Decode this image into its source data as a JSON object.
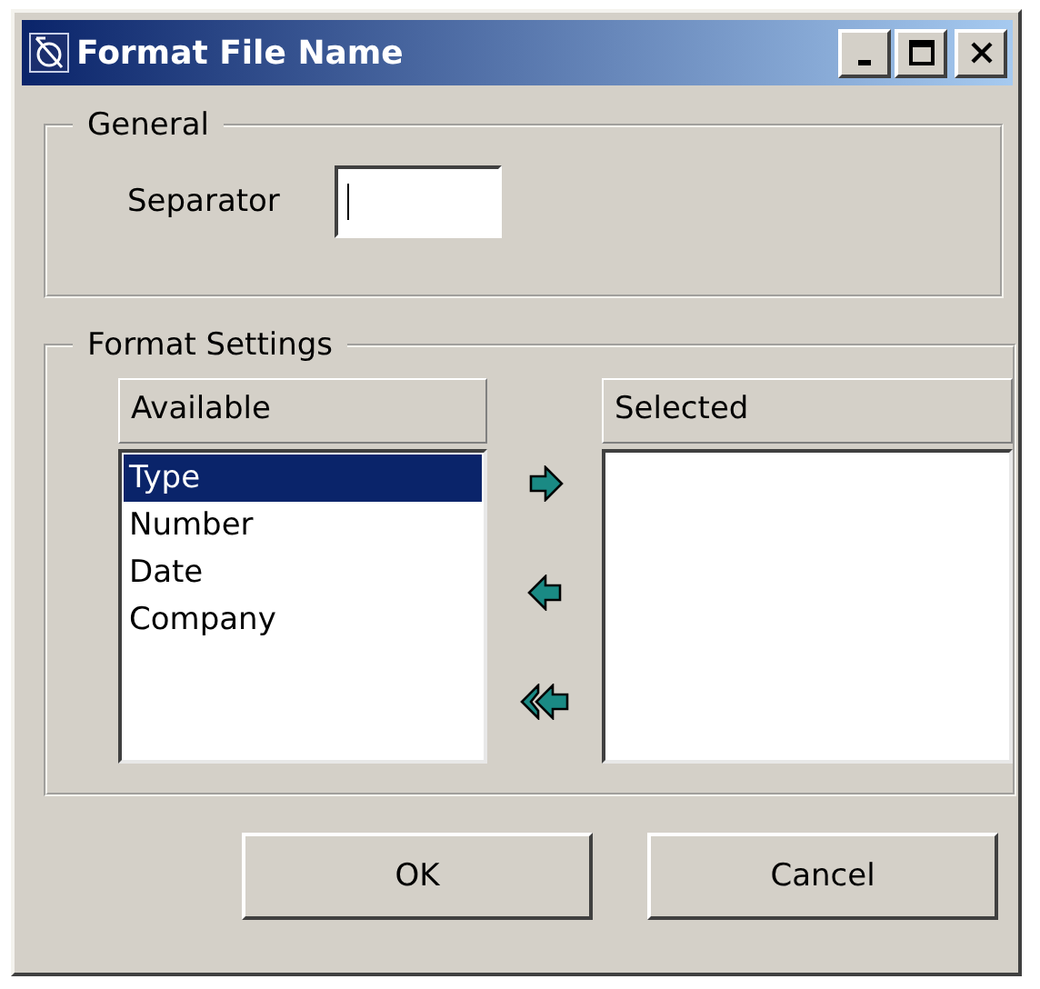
{
  "window": {
    "title": "Format File Name"
  },
  "general": {
    "legend": "General",
    "separator": {
      "label": "Separator",
      "focused": true
    }
  },
  "format_settings": {
    "legend": "Format Settings",
    "available": {
      "header": "Available",
      "items": [
        {
          "label": "Type",
          "selected": true
        },
        {
          "label": "Number",
          "selected": false
        },
        {
          "label": "Date",
          "selected": false
        },
        {
          "label": "Company",
          "selected": false
        }
      ]
    },
    "transfer_buttons": [
      {
        "kind": "add"
      },
      {
        "kind": "remove"
      },
      {
        "kind": "remove_all"
      }
    ],
    "selected": {
      "header": "Selected"
    }
  },
  "buttons": [
    {
      "label": "OK"
    },
    {
      "label": "Cancel"
    }
  ]
}
